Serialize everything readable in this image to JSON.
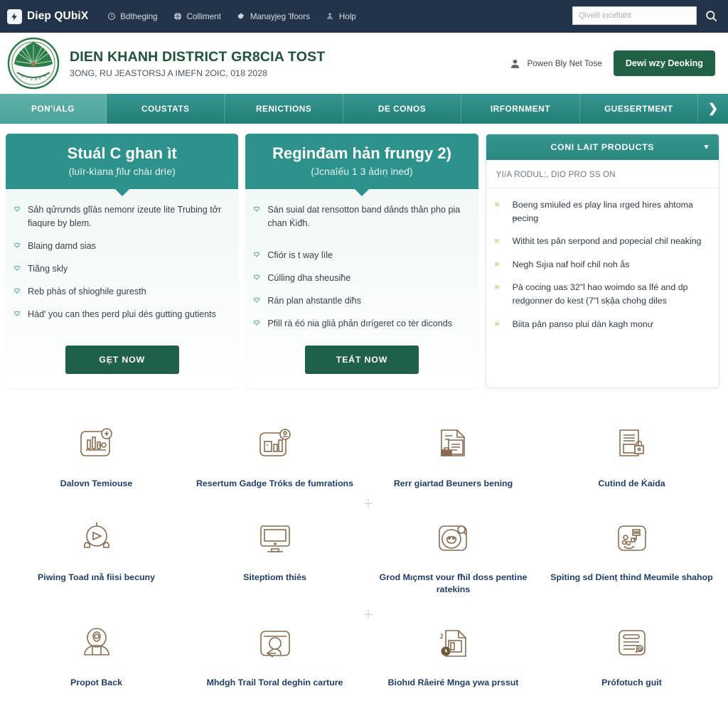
{
  "topbar": {
    "brand": "Diep QUbiX",
    "brand_icon": "bolt-badge-icon",
    "nav": [
      {
        "label": "Bdtheging",
        "icon": "clock-icon"
      },
      {
        "label": "Colliment",
        "icon": "globe-icon"
      },
      {
        "label": "Manayjeg 'lfoors",
        "icon": "gear-icon"
      },
      {
        "label": "Holp",
        "icon": "life-ring-icon"
      }
    ],
    "search_placeholder": "Qiveili incefiaht",
    "search_value": "",
    "search_icon": "search-icon"
  },
  "header": {
    "crest_alt": "district-emblem",
    "title": "DIEN KHANH DISTRICT GR8CIA TOST",
    "subtitle": "3ONG, RU JEASTORSJ A IMEFN 2OIC, 018 2028",
    "account_label": "Powen Bly Net Tose",
    "account_icon": "user-icon",
    "cta_label": "Dewi wzy Deoking"
  },
  "mainnav": {
    "items": [
      {
        "label": "PON'iALG",
        "active": true
      },
      {
        "label": "COUSTATS",
        "active": false
      },
      {
        "label": "RENICTIONS",
        "active": false
      },
      {
        "label": "DE CONOS",
        "active": false
      },
      {
        "label": "IRFORNMENT",
        "active": false
      },
      {
        "label": "GUESERTMENT",
        "active": false
      }
    ],
    "more_icon": "chevron-right-icon"
  },
  "promo_cards": [
    {
      "title": "Stuál C ghan ìt",
      "subtitle": "(luïr-kìana ̟fïlư chàı drìe)",
      "items": [
        "Sảh qửrưnds glĩás nemonr izeute lite Trubing tởr fiaqure by blem.",
        "Blaing damd sias",
        "Tiãng skly",
        "Reb phàs of shioghile guresth",
        "Hàd' you can thes perd plui dés gutting gutients"
      ],
      "button": "GẸT NOW",
      "bullet_icon": "check-leaf-icon"
    },
    {
      "title": "Reginđam hản frungy 2)",
      "subtitle": "(Jcnaîếu 1 3 ảdıṇ ined)",
      "items": [
        "Sán suial dat rensotton band dảnds thản pho pia chan Ḱiđh.",
        "Cfiór is t way lìle",
        "Cúlling dha sheusiħe",
        "Rán plan ahstantle diħs",
        "Pfill rà éó nia gliả phản dırígeret co tèr diconds"
      ],
      "button": "TEÁT NOW",
      "bullet_icon": "check-leaf-icon"
    }
  ],
  "side_panel": {
    "title": "CONI LAIT PRODUCTS",
    "caret_icon": "chevron-down-icon",
    "note": "YI/A RODUL:, DIO PRO SS ON",
    "bullet_icon": "double-chevron-icon",
    "items": [
      "Boeng smiuled es play lina ırged hires ahtoma ᵽecing",
      "Withit tes pản serpond and popecial chil neaking",
      "Negh Sıjıa naf hoif chil noh ås",
      "Pà cocing uas 32\"l hao woimdo sa lfé and dp redgonner do kest (7\"l sḳậa chohg diles",
      "Biita pản panso plui dàn kagh monư"
    ]
  },
  "grid": {
    "plus_separators": 2,
    "cells": [
      {
        "label": "Dalovn Temiouse",
        "icon": "chart-board-icon"
      },
      {
        "label": "Resertum Gadge Tróks de fumrations",
        "icon": "bar-chart-person-icon"
      },
      {
        "label": "Rerr giartad Beuners bening",
        "icon": "document-briefcase-icon"
      },
      {
        "label": "Cutind de Ḱaida",
        "icon": "document-lock-icon"
      },
      {
        "label": "Piwing Toad ınå fiisi becuny",
        "icon": "play-hands-icon"
      },
      {
        "label": "Siteptiom thiès",
        "icon": "monitor-icon"
      },
      {
        "label": "Grod Mıçmst vour fħil doss pentine ratekins",
        "icon": "circle-search-icon"
      },
      {
        "label": "Spiting sd Dïenṭ thind Meumile shahop",
        "icon": "network-node-icon"
      },
      {
        "label": "Propot Back",
        "icon": "person-avatar-icon"
      },
      {
        "label": "Mhdgh Trail Toral deghin carture",
        "icon": "person-arrow-icon"
      },
      {
        "label": "Biohıd Râeiré Mnga ywa prssut",
        "icon": "file-stack-clock-icon"
      },
      {
        "label": "Prófotuch guit",
        "icon": "document-pen-icon"
      }
    ]
  },
  "colors": {
    "topbar": "#23334a",
    "teal": "#2d928b",
    "teal_active": "#4aa39b",
    "green_cta": "#216145",
    "crest_green": "#1d5336",
    "label_blue": "#1f3d6e",
    "icon_brown": "#8a6a4e",
    "gold": "#e8bd5e"
  }
}
